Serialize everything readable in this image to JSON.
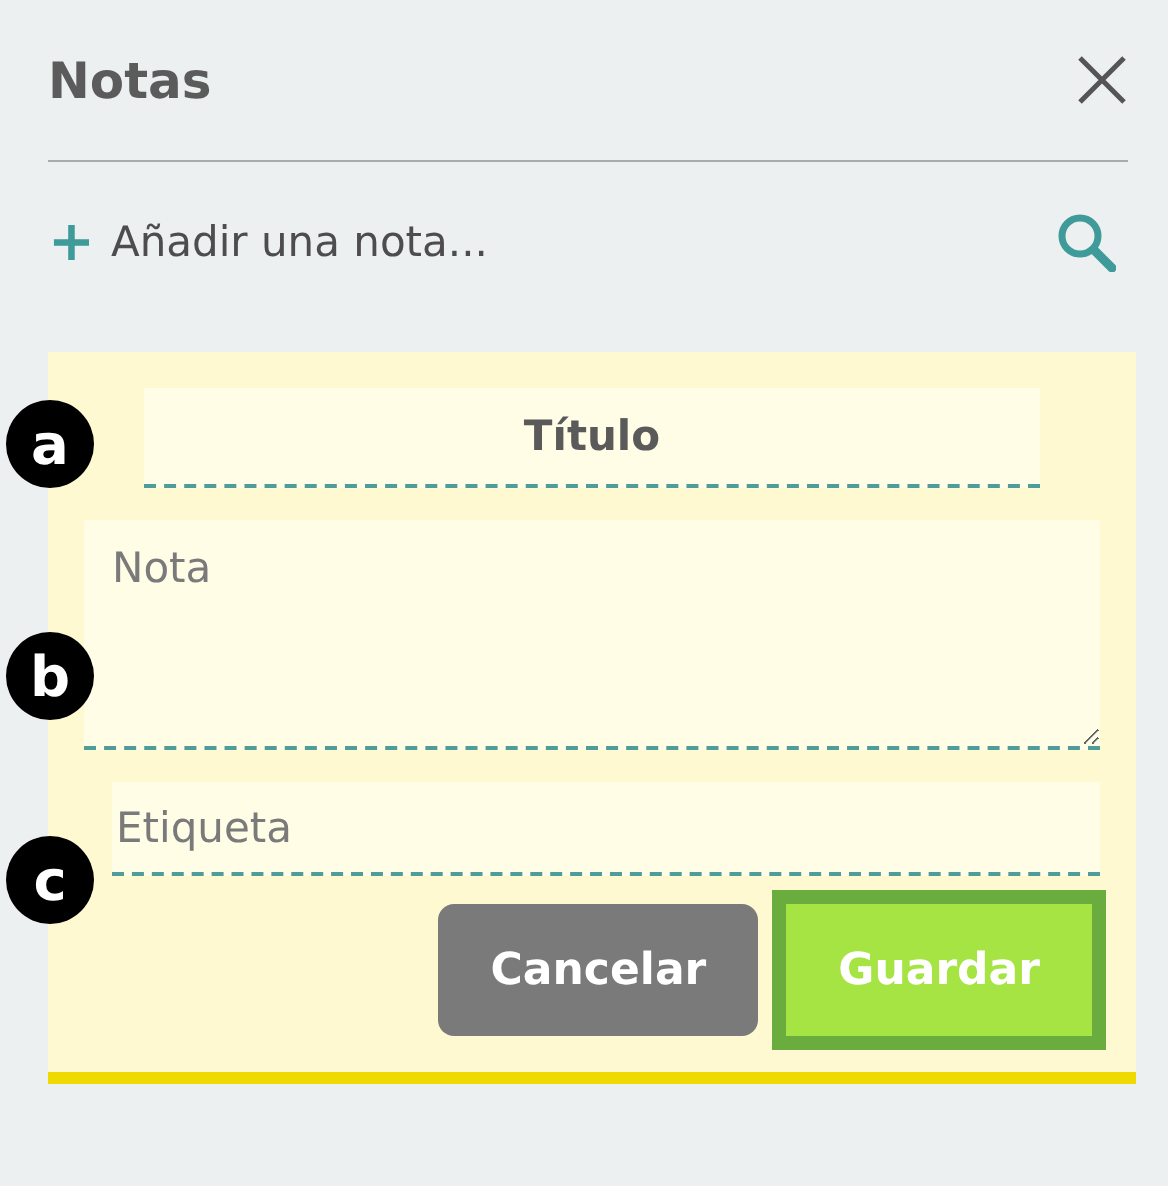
{
  "header": {
    "title": "Notas"
  },
  "add_note": {
    "plus": "+",
    "label": "Añadir una nota..."
  },
  "form": {
    "fields": [
      {
        "kind": "title",
        "placeholder": "Título",
        "marker": "a"
      },
      {
        "kind": "note",
        "placeholder": "Nota",
        "marker": "b"
      },
      {
        "kind": "tag",
        "placeholder": "Etiqueta",
        "marker": "c"
      }
    ],
    "buttons": [
      {
        "label": "Cancelar",
        "kind": "secondary",
        "focused": false
      },
      {
        "label": "Guardar",
        "kind": "primary",
        "focused": true
      }
    ]
  }
}
